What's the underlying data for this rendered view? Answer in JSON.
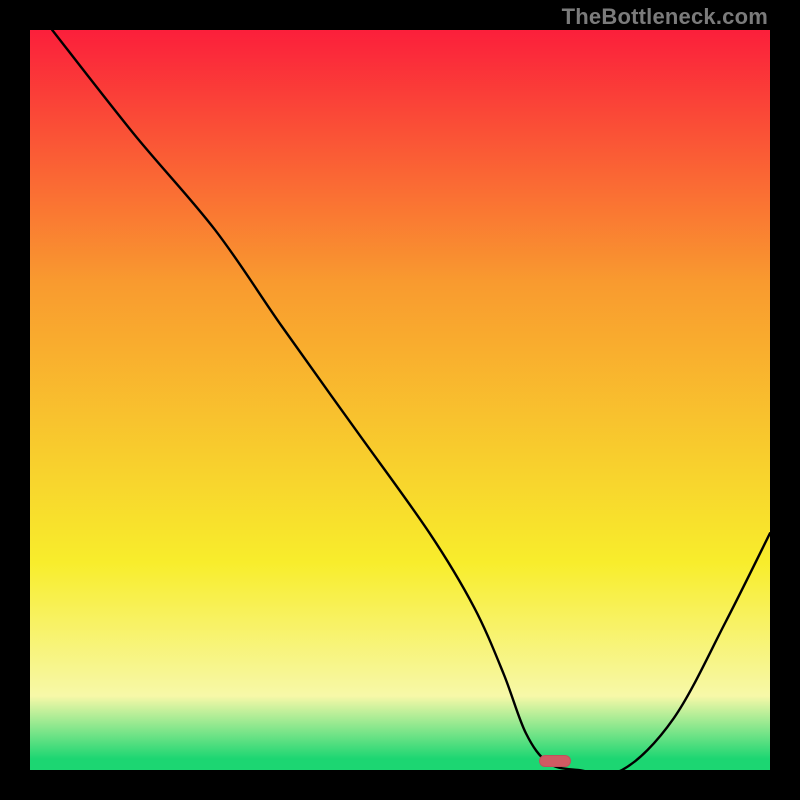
{
  "watermark": "TheBottleneck.com",
  "colors": {
    "red": "#fb1f3b",
    "orange": "#f99a2f",
    "yellow": "#f8ed2c",
    "pale_yellow": "#f7f8a8",
    "green": "#1cd672",
    "black": "#000000",
    "marker": "#cf5b63",
    "curve": "#000000"
  },
  "chart_data": {
    "type": "line",
    "title": "",
    "xlabel": "",
    "ylabel": "",
    "xlim": [
      0,
      100
    ],
    "ylim": [
      0,
      100
    ],
    "gradient_stops": [
      {
        "pos": 0.0,
        "color": "#fb1f3b"
      },
      {
        "pos": 0.34,
        "color": "#f99a2f"
      },
      {
        "pos": 0.72,
        "color": "#f8ed2c"
      },
      {
        "pos": 0.9,
        "color": "#f7f8a8"
      },
      {
        "pos": 0.985,
        "color": "#1cd672"
      }
    ],
    "series": [
      {
        "name": "bottleneck-curve",
        "x": [
          3,
          14,
          25,
          34,
          44,
          54,
          60,
          64,
          67,
          70,
          74,
          80,
          87,
          94,
          100
        ],
        "y": [
          100,
          86,
          73,
          60,
          46,
          32,
          22,
          13,
          5,
          1,
          0,
          0,
          7,
          20,
          32
        ]
      }
    ],
    "marker": {
      "x": 71,
      "y": 1.2
    }
  }
}
